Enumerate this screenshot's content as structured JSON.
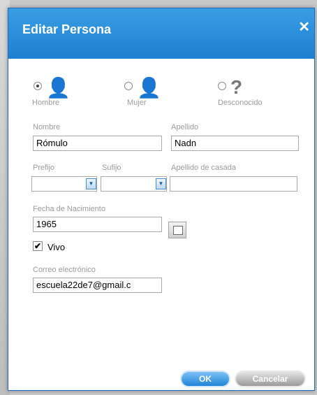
{
  "dialog": {
    "title": "Editar Persona",
    "close_glyph": "✕"
  },
  "gender": [
    {
      "label": "Hombre",
      "icon": "male-person-icon",
      "glyph": "👤",
      "color": "#2a7be0",
      "selected": true
    },
    {
      "label": "Mujer",
      "icon": "female-person-icon",
      "glyph": "👤",
      "color": "#e83e9e",
      "selected": false
    },
    {
      "label": "Desconocido",
      "icon": "question-mark-icon",
      "glyph": "?",
      "color": "#777777",
      "selected": false
    }
  ],
  "fields": {
    "nombre_label": "Nombre",
    "nombre_value": "Rómulo",
    "apellido_label": "Apellido",
    "apellido_value": "Nadn",
    "prefijo_label": "Prefijo",
    "sufijo_label": "Sufijo",
    "apellido_casada_label": "Apellido de casada",
    "fecha_label": "Fecha de Nacimiento",
    "fecha_value": "1965",
    "vivo_label": "Vivo",
    "vivo_checked": true,
    "correo_label": "Correo electrónico",
    "correo_value": "escuela22de7@gmail.c"
  },
  "buttons": {
    "ok": "OK",
    "cancel": "Cancelar"
  }
}
